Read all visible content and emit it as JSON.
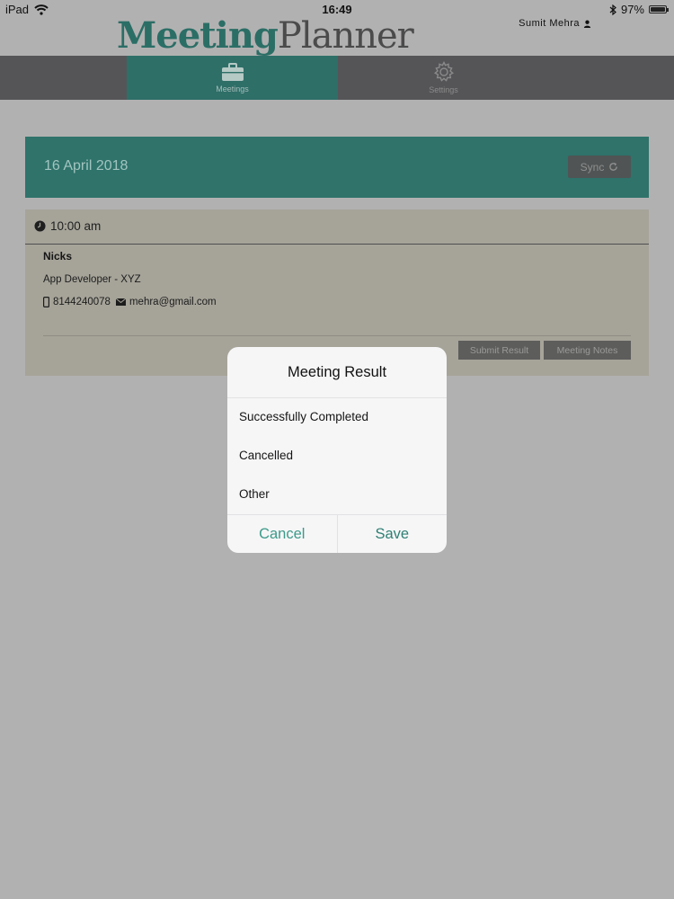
{
  "status_bar": {
    "device": "iPad",
    "time": "16:49",
    "battery": "97%",
    "battery_level": 0.97
  },
  "app": {
    "title_part1": "Meeting",
    "title_part2": "Planner"
  },
  "user": {
    "name": "Sumit Mehra"
  },
  "tabs": [
    {
      "label": "Meetings",
      "active": true,
      "icon": "briefcase-icon"
    },
    {
      "label": "Settings",
      "active": false,
      "icon": "gear-icon"
    }
  ],
  "date_card": {
    "date": "16 April 2018",
    "sync_label": "Sync"
  },
  "meeting": {
    "time": "10:00 am",
    "name": "Nicks",
    "role": "App Developer - XYZ",
    "phone": "8144240078",
    "email": "mehra@gmail.com",
    "submit_label": "Submit Result",
    "notes_label": "Meeting Notes"
  },
  "dialog": {
    "title": "Meeting Result",
    "options": [
      "Successfully Completed",
      "Cancelled",
      "Other"
    ],
    "cancel_label": "Cancel",
    "save_label": "Save"
  },
  "colors": {
    "accent": "#2f736b",
    "nav": "#555558",
    "background": "#b2b1b1",
    "dialog_action": "#3c9a89"
  }
}
